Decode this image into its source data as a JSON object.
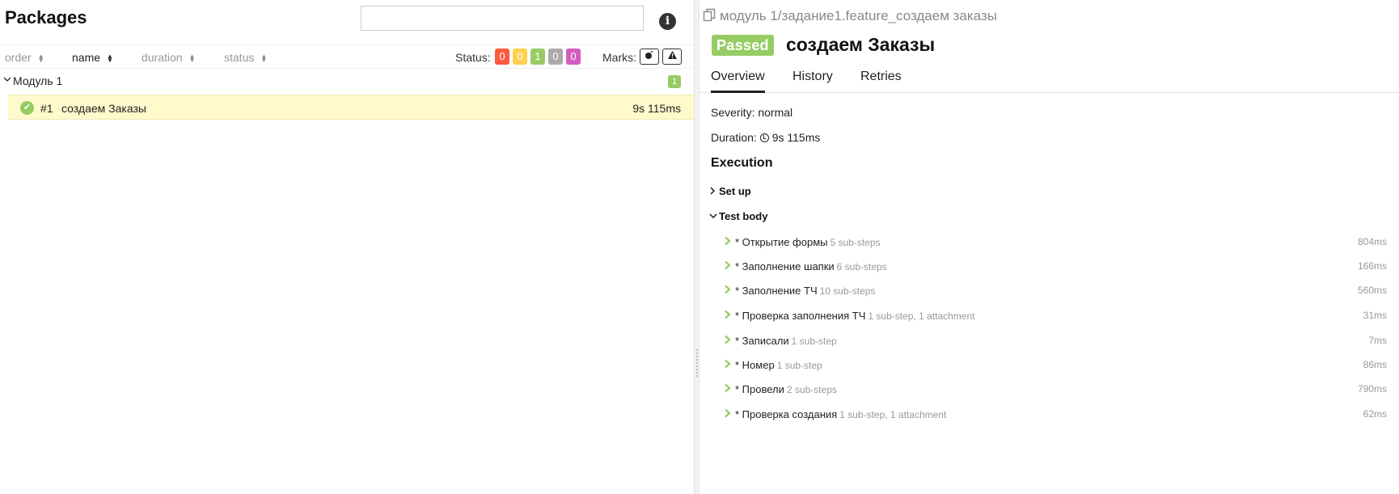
{
  "left": {
    "title": "Packages",
    "search_placeholder": "",
    "sort_columns": [
      {
        "label": "order",
        "active": false
      },
      {
        "label": "name",
        "active": true
      },
      {
        "label": "duration",
        "active": false
      },
      {
        "label": "status",
        "active": false
      }
    ],
    "status_label": "Status:",
    "status_counts": [
      {
        "kind": "failed",
        "count": "0",
        "color": "#fd5a3e"
      },
      {
        "kind": "broken",
        "count": "0",
        "color": "#ffd050"
      },
      {
        "kind": "passed",
        "count": "1",
        "color": "#97cc64"
      },
      {
        "kind": "skipped",
        "count": "0",
        "color": "#aaaaaa"
      },
      {
        "kind": "unknown",
        "count": "0",
        "color": "#d35ebe"
      }
    ],
    "marks_label": "Marks:",
    "marks_icons": [
      "bomb-icon",
      "warning-icon"
    ],
    "group": {
      "name": "Модуль 1",
      "count": "1"
    },
    "test": {
      "number": "#1",
      "name": "создаем Заказы",
      "duration": "9s 115ms"
    }
  },
  "right": {
    "breadcrumb": "модуль 1/задание1.feature_создаем заказы",
    "status_badge": "Passed",
    "title": "создаем Заказы",
    "tabs": [
      "Overview",
      "History",
      "Retries"
    ],
    "severity": "Severity: normal",
    "duration_label": "Duration:",
    "duration_value": "9s 115ms",
    "execution_title": "Execution",
    "setup_label": "Set up",
    "test_body_label": "Test body",
    "steps": [
      {
        "name": "* Открытие формы",
        "sub": "5 sub-steps",
        "duration": "804ms"
      },
      {
        "name": "* Заполнение шапки",
        "sub": "6 sub-steps",
        "duration": "166ms"
      },
      {
        "name": "* Заполнение ТЧ",
        "sub": "10 sub-steps",
        "duration": "560ms"
      },
      {
        "name": "* Проверка заполнения ТЧ",
        "sub": "1 sub-step, 1 attachment",
        "duration": "31ms"
      },
      {
        "name": "* Записали",
        "sub": "1 sub-step",
        "duration": "7ms"
      },
      {
        "name": "* Номер",
        "sub": "1 sub-step",
        "duration": "86ms"
      },
      {
        "name": "* Провели",
        "sub": "2 sub-steps",
        "duration": "790ms"
      },
      {
        "name": "* Проверка создания",
        "sub": "1 sub-step, 1 attachment",
        "duration": "62ms"
      }
    ],
    "colors": {
      "passed": "#97cc64",
      "selected_row": "#fff9cc"
    }
  }
}
